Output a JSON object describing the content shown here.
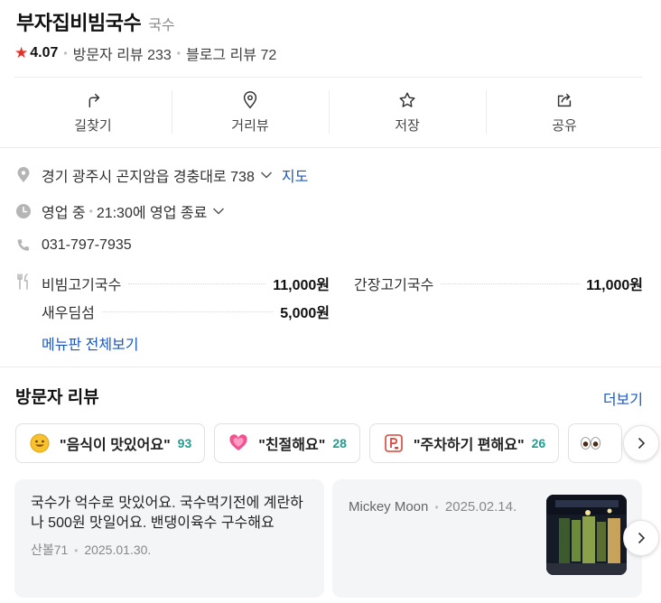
{
  "place": {
    "name": "부자집비빔국수",
    "category": "국수",
    "rating": "4.07",
    "visitor_reviews": "방문자 리뷰 233",
    "blog_reviews": "블로그 리뷰 72"
  },
  "actions": [
    {
      "label": "길찾기",
      "icon": "directions-icon"
    },
    {
      "label": "거리뷰",
      "icon": "pin-icon"
    },
    {
      "label": "저장",
      "icon": "star-outline-icon"
    },
    {
      "label": "공유",
      "icon": "share-icon"
    }
  ],
  "info": {
    "address": "경기 광주시 곤지암읍 경충대로 738",
    "map_link": "지도",
    "status": "영업 중",
    "hours": "21:30에 영업 종료",
    "phone": "031-797-7935"
  },
  "menu": {
    "items": [
      {
        "name": "비빔고기국수",
        "price": "11,000원"
      },
      {
        "name": "간장고기국수",
        "price": "11,000원"
      },
      {
        "name": "새우딤섬",
        "price": "5,000원"
      }
    ],
    "view_all": "메뉴판 전체보기"
  },
  "reviews_section": {
    "title": "방문자 리뷰",
    "more": "더보기",
    "keywords": [
      {
        "text": "\"음식이 맛있어요\"",
        "count": "93",
        "icon": "smile-emoji-icon"
      },
      {
        "text": "\"친절해요\"",
        "count": "28",
        "icon": "heart-emoji-icon"
      },
      {
        "text": "\"주차하기 편해요\"",
        "count": "26",
        "icon": "parking-icon"
      }
    ],
    "reviews": [
      {
        "text": "국수가 억수로 맛있어요. 국수먹기전에 계란하나 500원 맛일어요. 밴댕이육수 구수해요",
        "author": "산볼71",
        "date": "2025.01.30."
      },
      {
        "author": "Mickey Moon",
        "date": "2025.02.14."
      }
    ]
  },
  "colors": {
    "accent_blue": "#1a56c6",
    "star_red": "#e5312b",
    "count_teal": "#1f9e8e"
  }
}
